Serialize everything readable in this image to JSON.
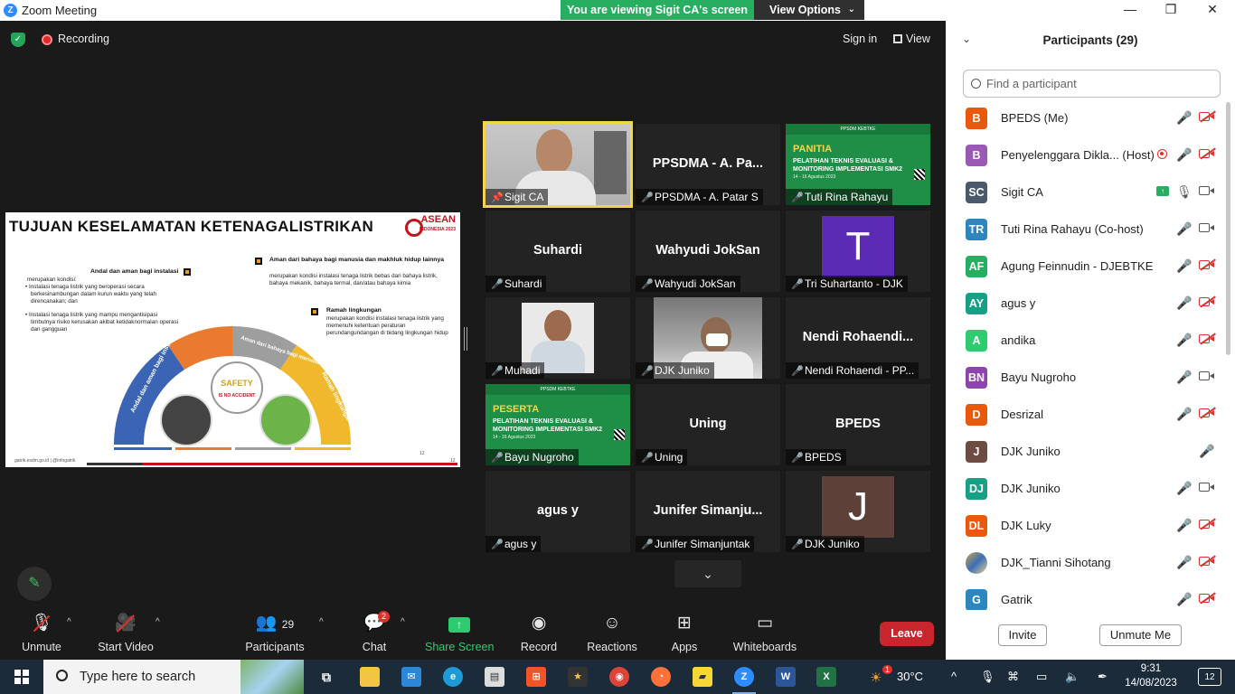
{
  "window": {
    "title": "Zoom Meeting",
    "viewing_banner": "You are viewing Sigit CA's screen",
    "view_options": "View Options"
  },
  "topbar": {
    "recording": "Recording",
    "sign_in": "Sign in",
    "view": "View"
  },
  "slide": {
    "title": "TUJUAN KESELAMATAN KETENAGALISTRIKAN",
    "logo_text": "ASEAN",
    "logo_sub": "INDONESIA 2023",
    "b1_head": "Andal dan aman bagi instalasi",
    "b1_text": "merupakan kondisi:",
    "b1_item1": "Instalasi tenaga listrik yang beroperasi secara berkesinambungan dalam kurun waktu yang telah direncanakan; dan",
    "b1_item2": "Instalasi tenaga listrik yang mampu mengantisipasi timbulnya risiko kerusakan akibat ketidaknormalan operasi dan gangguan",
    "b2_head": "Aman dari bahaya bagi manusia dan makhluk hidup lainnya",
    "b2_text": "merupakan kondisi instalasi tenaga listrik bebas dari bahaya listrik, bahaya mekanik, bahaya termal, dan/atau bahaya kimia",
    "b3_head": "Ramah lingkungan",
    "b3_text": "merupakan kondisi instalasi tenaga listrik yang memenuhi ketentuan peraturan perundangundangan di bidang lingkungan hidup",
    "arc1": "Andal dan aman bagi instalasi",
    "arc2": "Aman dari bahaya bagi manusia dan makhluk hidup lainnya",
    "arc3": "Ramah lingkungan",
    "safety": "SAFETY",
    "safety_sub": "IS NO ACCIDENT",
    "footer": "gatrik.esdm.go.id | @infogatrik",
    "page_a": "12",
    "page_b": "12"
  },
  "tiles": [
    {
      "big": "",
      "name": "Sigit CA"
    },
    {
      "big": "PPSDMA - A. Pa...",
      "name": "PPSDMA - A. Patar S"
    },
    {
      "big": "",
      "name": "Tuti Rina Rahayu",
      "banner_title": "PANITIA",
      "banner_sub": "PELATIHAN TEKNIS EVALUASI & MONITORING IMPLEMENTASI SMK2",
      "banner_date": "14 - 16 Agustus 2023",
      "banner_top": "PPSDM KEBTKE"
    },
    {
      "big": "Suhardi",
      "name": "Suhardi"
    },
    {
      "big": "Wahyudi JokSan",
      "name": "Wahyudi JokSan"
    },
    {
      "big": "",
      "name": "Tri Suhartanto - DJK",
      "avatar": "T"
    },
    {
      "big": "",
      "name": "Muhadi"
    },
    {
      "big": "",
      "name": "DJK Juniko"
    },
    {
      "big": "Nendi Rohaendi...",
      "name": "Nendi Rohaendi - PP..."
    },
    {
      "big": "",
      "name": "Bayu Nugroho",
      "banner_title": "PESERTA",
      "banner_sub": "PELATIHAN TEKNIS EVALUASI & MONITORING IMPLEMENTASI SMK2",
      "banner_date": "14 - 16 Agustus 2023",
      "banner_top": "PPSDM KEBTKE"
    },
    {
      "big": "Uning",
      "name": "Uning"
    },
    {
      "big": "BPEDS",
      "name": "BPEDS"
    },
    {
      "big": "agus y",
      "name": "agus y"
    },
    {
      "big": "Junifer Simanju...",
      "name": "Junifer Simanjuntak"
    },
    {
      "big": "",
      "name": "DJK Juniko",
      "avatar": "J"
    }
  ],
  "toolbar": {
    "unmute": "Unmute",
    "start_video": "Start Video",
    "participants": "Participants",
    "participants_count": "29",
    "chat": "Chat",
    "chat_badge": "2",
    "share_screen": "Share Screen",
    "record": "Record",
    "reactions": "Reactions",
    "apps": "Apps",
    "whiteboards": "Whiteboards",
    "leave": "Leave"
  },
  "panel": {
    "title": "Participants (29)",
    "search_placeholder": "Find a participant",
    "invite": "Invite",
    "unmute_me": "Unmute Me",
    "participants": [
      {
        "initials": "B",
        "name": "BPEDS (Me)",
        "color": "#e8590c",
        "cam": "off"
      },
      {
        "initials": "B",
        "name": "Penyelenggara Dikla... (Host)",
        "color": "#9b59b6",
        "cam": "off",
        "rec": true
      },
      {
        "initials": "SC",
        "name": "Sigit CA",
        "color": "#4a5a6a",
        "cam": "on",
        "mic": "on",
        "share": true
      },
      {
        "initials": "TR",
        "name": "Tuti Rina Rahayu (Co-host)",
        "color": "#2e86c1",
        "cam": "on"
      },
      {
        "initials": "AF",
        "name": "Agung Feinnudin - DJEBTKE",
        "color": "#27ae60",
        "cam": "off"
      },
      {
        "initials": "AY",
        "name": "agus y",
        "color": "#16a085",
        "cam": "off"
      },
      {
        "initials": "A",
        "name": "andika",
        "color": "#2ecc71",
        "cam": "off"
      },
      {
        "initials": "BN",
        "name": "Bayu Nugroho",
        "color": "#8e44ad",
        "cam": "on"
      },
      {
        "initials": "D",
        "name": "Desrizal",
        "color": "#e8590c",
        "cam": "off"
      },
      {
        "initials": "J",
        "name": "DJK Juniko",
        "color": "#6d4c41",
        "cam": "none"
      },
      {
        "initials": "DJ",
        "name": "DJK Juniko",
        "color": "#16a085",
        "cam": "on"
      },
      {
        "initials": "DL",
        "name": "DJK Luky",
        "color": "#e8590c",
        "cam": "off"
      },
      {
        "initials": "",
        "name": "DJK_Tianni Sihotang",
        "color": "#c9a54a",
        "cam": "off",
        "photo": true
      },
      {
        "initials": "G",
        "name": "Gatrik",
        "color": "#2e86c1",
        "cam": "off"
      }
    ]
  },
  "taskbar": {
    "search_placeholder": "Type here to search",
    "weather": "30°C",
    "weather_badge": "1",
    "time": "9:31",
    "date": "14/08/2023",
    "notifications": "12",
    "apps": [
      "task-view",
      "file-explorer",
      "mail",
      "edge",
      "store-bag",
      "store",
      "chess",
      "chrome",
      "firefox",
      "sticky-notes",
      "zoom",
      "word",
      "excel"
    ]
  }
}
